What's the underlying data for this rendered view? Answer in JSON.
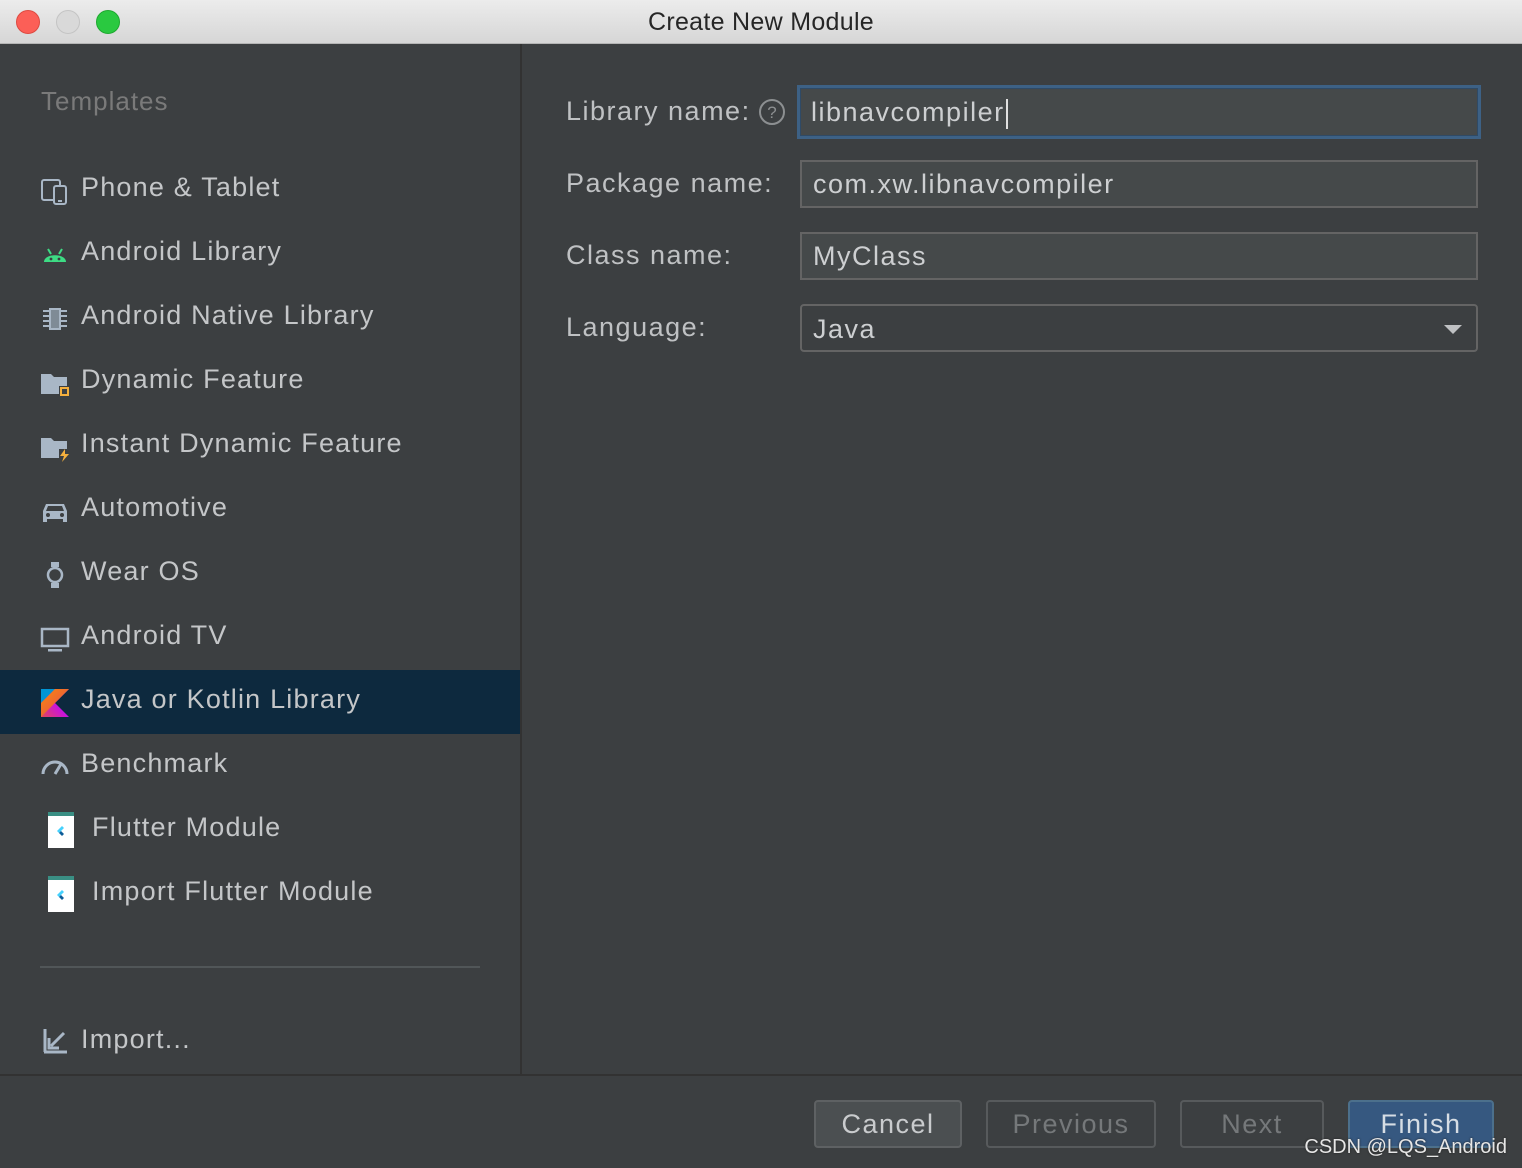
{
  "window": {
    "title": "Create New Module"
  },
  "sidebar": {
    "header": "Templates",
    "items": [
      {
        "label": "Phone & Tablet",
        "icon": "phone-tablet-icon"
      },
      {
        "label": "Android Library",
        "icon": "android-icon"
      },
      {
        "label": "Android Native Library",
        "icon": "native-chip-icon"
      },
      {
        "label": "Dynamic Feature",
        "icon": "dynamic-feature-folder-icon"
      },
      {
        "label": "Instant Dynamic Feature",
        "icon": "instant-feature-folder-icon"
      },
      {
        "label": "Automotive",
        "icon": "car-icon"
      },
      {
        "label": "Wear OS",
        "icon": "watch-icon"
      },
      {
        "label": "Android TV",
        "icon": "tv-icon"
      },
      {
        "label": "Java or Kotlin Library",
        "icon": "kotlin-icon",
        "selected": true
      },
      {
        "label": "Benchmark",
        "icon": "gauge-icon"
      },
      {
        "label": "Flutter Module",
        "icon": "flutter-icon"
      },
      {
        "label": "Import Flutter Module",
        "icon": "flutter-icon"
      }
    ],
    "import_label": "Import..."
  },
  "form": {
    "library_name_label": "Library name:",
    "library_name_value": "libnavcompiler",
    "package_name_label": "Package name:",
    "package_name_value": "com.xw.libnavcompiler",
    "class_name_label": "Class name:",
    "class_name_value": "MyClass",
    "language_label": "Language:",
    "language_value": "Java"
  },
  "buttons": {
    "cancel": "Cancel",
    "previous": "Previous",
    "next": "Next",
    "finish": "Finish"
  },
  "watermark": "CSDN @LQS_Android",
  "colors": {
    "background": "#3c3f41",
    "selection": "#0d293e",
    "primary_button": "#365880",
    "focus_border": "#3d6185"
  }
}
